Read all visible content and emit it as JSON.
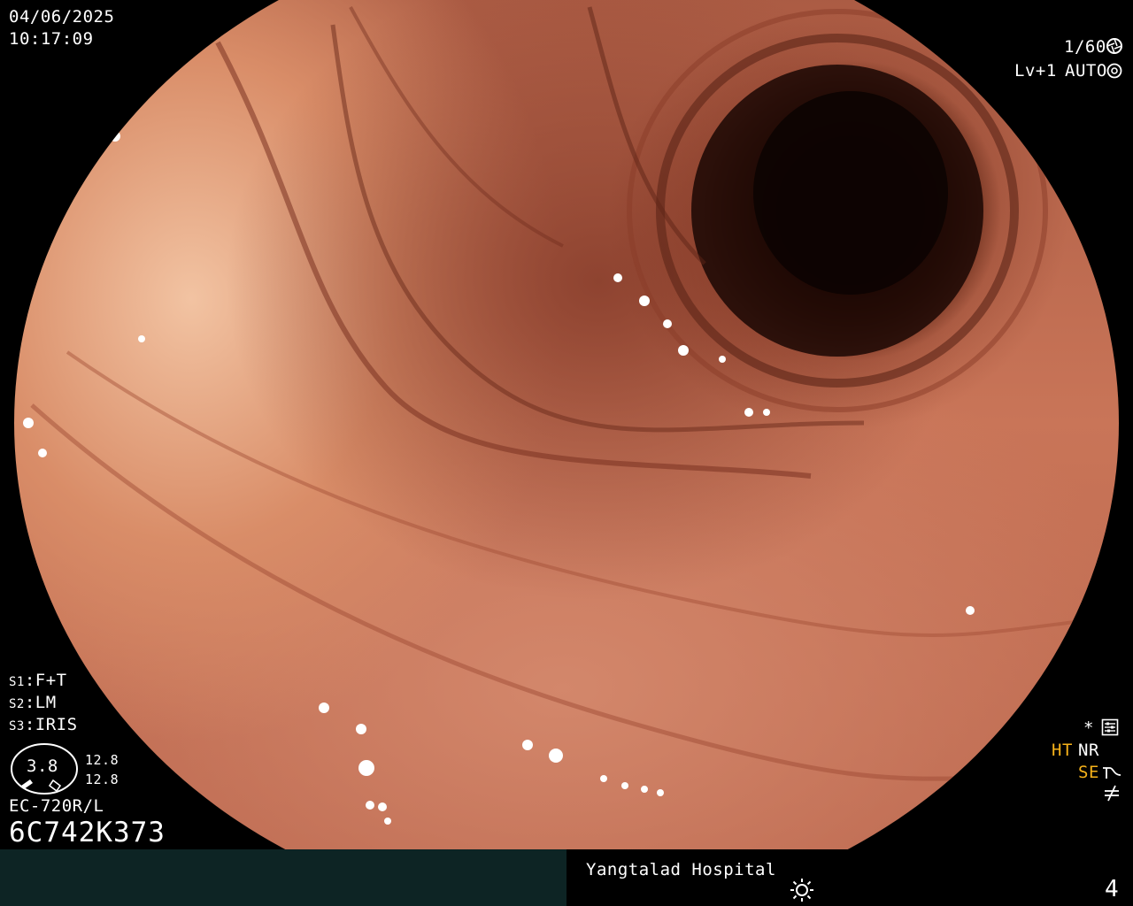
{
  "overlay": {
    "date": "04/06/2025",
    "time": "10:17:09",
    "shutter": "1/60",
    "level": "Lv+1",
    "iris_mode": "AUTO",
    "settings": {
      "s1_label": "S1",
      "s1_value": ":F+T",
      "s2_label": "S2",
      "s2_value": ":LM",
      "s3_label": "S3",
      "s3_value": ":IRIS"
    },
    "gauge_value": "3.8",
    "gauge_top": "12.8",
    "gauge_bottom": "12.8",
    "scope_model": "EC-720R/L",
    "scope_serial": "6C742K373",
    "right_status": {
      "star": "*",
      "ht": "HT",
      "nr": "NR",
      "se": "SE"
    }
  },
  "footer": {
    "hospital": "Yangtalad Hospital",
    "page_number": "4"
  },
  "colors": {
    "text": "#ffffff",
    "highlight": "#f6b21a",
    "footer_left_bg": "#0d2424"
  },
  "icons": {
    "shutter": "aperture-icon",
    "iris": "iris-icon",
    "settings": "settings-sliders-icon",
    "enhance": "curve-icon",
    "not_equal": "not-equal-icon",
    "brightness": "sun-icon"
  }
}
